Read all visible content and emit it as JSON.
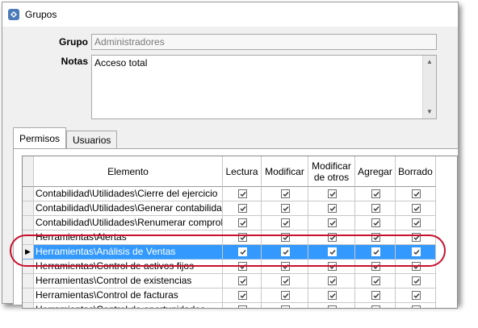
{
  "window": {
    "title": "Grupos"
  },
  "form": {
    "grupo_label": "Grupo",
    "grupo_value": "Administradores",
    "notas_label": "Notas",
    "notas_value": "Acceso total"
  },
  "tabs": [
    {
      "label": "Permisos",
      "active": true
    },
    {
      "label": "Usuarios",
      "active": false
    }
  ],
  "grid": {
    "columns": {
      "elemento": "Elemento",
      "lectura": "Lectura",
      "modificar": "Modificar",
      "modificar_otros": "Modificar de otros",
      "agregar": "Agregar",
      "borrado": "Borrado"
    },
    "rows": [
      {
        "elemento": "Contabilidad\\Utilidades\\Cierre del ejercicio",
        "lectura": true,
        "modificar": true,
        "modificar_otros": true,
        "agregar": true,
        "borrado": true
      },
      {
        "elemento": "Contabilidad\\Utilidades\\Generar contabilidad",
        "lectura": true,
        "modificar": true,
        "modificar_otros": true,
        "agregar": true,
        "borrado": true
      },
      {
        "elemento": "Contabilidad\\Utilidades\\Renumerar comprobantes",
        "lectura": true,
        "modificar": true,
        "modificar_otros": true,
        "agregar": true,
        "borrado": true
      },
      {
        "elemento": "Herramientas\\Alertas",
        "lectura": true,
        "modificar": true,
        "modificar_otros": true,
        "agregar": true,
        "borrado": true
      },
      {
        "elemento": "Herramientas\\Análisis de Ventas",
        "lectura": true,
        "modificar": true,
        "modificar_otros": true,
        "agregar": true,
        "borrado": true,
        "selected": true
      },
      {
        "elemento": "Herramientas\\Control de activos fijos",
        "lectura": true,
        "modificar": true,
        "modificar_otros": true,
        "agregar": true,
        "borrado": true
      },
      {
        "elemento": "Herramientas\\Control de existencias",
        "lectura": true,
        "modificar": true,
        "modificar_otros": true,
        "agregar": true,
        "borrado": true
      },
      {
        "elemento": "Herramientas\\Control de facturas",
        "lectura": true,
        "modificar": true,
        "modificar_otros": true,
        "agregar": true,
        "borrado": true
      },
      {
        "elemento": "Herramientas\\Control de oportunidades",
        "lectura": true,
        "modificar": true,
        "modificar_otros": true,
        "agregar": true,
        "borrado": true
      }
    ]
  },
  "colors": {
    "selection": "#3399ff",
    "annotation": "#c8102e"
  },
  "icons": {
    "app": "app-icon",
    "row_pointer": "row-pointer-icon"
  }
}
